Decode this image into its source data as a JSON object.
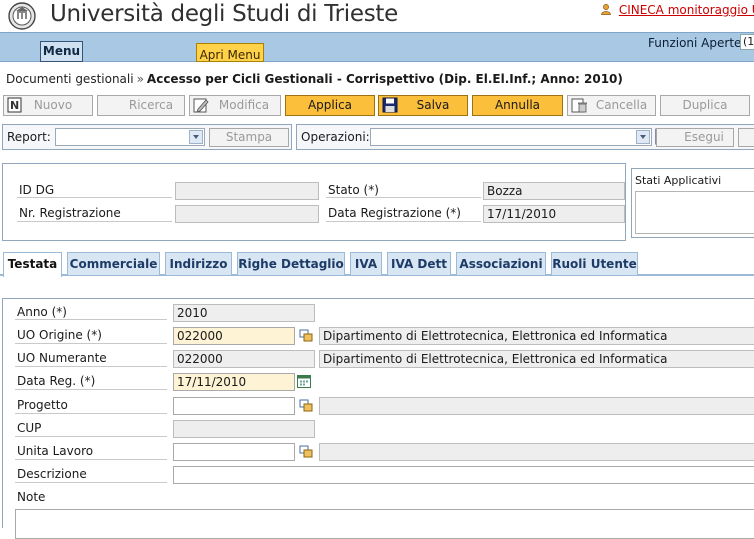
{
  "header": {
    "university_title": "Università degli Studi di Trieste",
    "cineca_link": "CINECA monitoraggio U"
  },
  "menubar": {
    "menu_label": "Menu",
    "apri_menu_label": "Apri Menu",
    "funzioni_label": "Funzioni Aperte:",
    "funzioni_value": "(1"
  },
  "breadcrumb": {
    "root": "Documenti gestionali",
    "separator": "»",
    "current": "Accesso per Cicli Gestionali - Corrispettivo (Dip. El.El.Inf.; Anno: 2010)"
  },
  "toolbar": {
    "nuovo": "Nuovo",
    "ricerca": "Ricerca",
    "modifica": "Modifica",
    "applica": "Applica",
    "salva": "Salva",
    "annulla": "Annulla",
    "cancella": "Cancella",
    "duplica": "Duplica"
  },
  "report": {
    "report_label": "Report:",
    "report_value": "",
    "stampa": "Stampa",
    "operazioni_label": "Operazioni:",
    "operazioni_value": "",
    "esegui": "Esegui"
  },
  "document": {
    "id_dg_label": "ID DG",
    "id_dg_value": "",
    "nr_reg_label": "Nr. Registrazione",
    "nr_reg_value": "",
    "stato_label": "Stato (*)",
    "stato_value": "Bozza",
    "data_reg_label": "Data Registrazione (*)",
    "data_reg_value": "17/11/2010",
    "stati_applicativi_label": "Stati Applicativi"
  },
  "tabs": [
    {
      "label": "Testata",
      "active": true
    },
    {
      "label": "Commerciale",
      "active": false
    },
    {
      "label": "Indirizzo",
      "active": false
    },
    {
      "label": "Righe Dettaglio",
      "active": false
    },
    {
      "label": "IVA",
      "active": false
    },
    {
      "label": "IVA Dett",
      "active": false
    },
    {
      "label": "Associazioni",
      "active": false
    },
    {
      "label": "Ruoli Utente",
      "active": false
    }
  ],
  "form": {
    "anno_label": "Anno (*)",
    "anno_value": "2010",
    "uo_origine_label": "UO Origine (*)",
    "uo_origine_code": "022000",
    "uo_origine_desc": "Dipartimento di Elettrotecnica, Elettronica ed Informatica",
    "uo_numerante_label": "UO Numerante",
    "uo_numerante_code": "022000",
    "uo_numerante_desc": "Dipartimento di Elettrotecnica, Elettronica ed Informatica",
    "data_reg_label": "Data Reg. (*)",
    "data_reg_value": "17/11/2010",
    "progetto_label": "Progetto",
    "progetto_code": "",
    "progetto_desc": "",
    "cup_label": "CUP",
    "cup_value": "",
    "unita_lavoro_label": "Unita Lavoro",
    "unita_lavoro_code": "",
    "unita_lavoro_desc": "",
    "descrizione_label": "Descrizione",
    "descrizione_value": "",
    "note_label": "Note",
    "note_value": ""
  },
  "colors": {
    "menubar": "#a9c8e4",
    "active_button": "#fbbf3c",
    "required_field": "#fff3d6",
    "link": "#cc0000"
  }
}
